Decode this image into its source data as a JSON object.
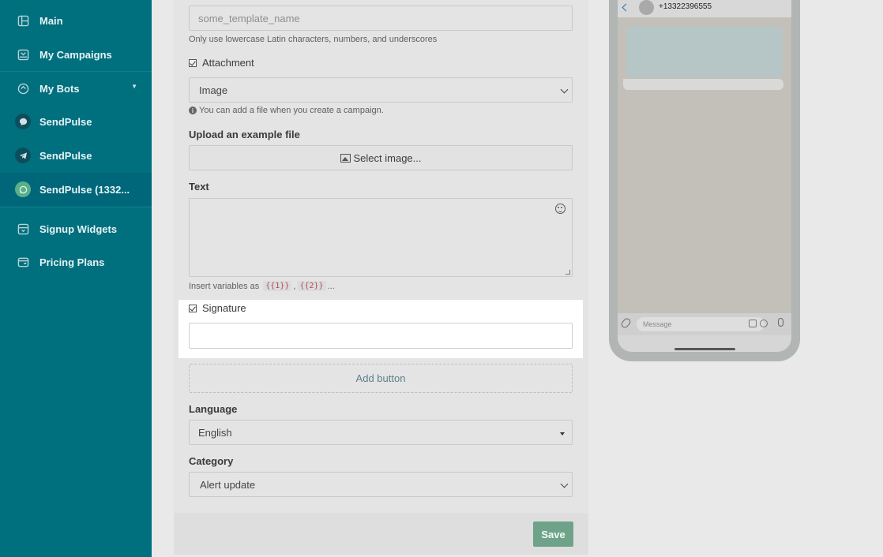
{
  "sidebar": {
    "items": [
      {
        "label": "Main",
        "icon": "dashboard-icon"
      },
      {
        "label": "My Campaigns",
        "icon": "campaigns-icon"
      },
      {
        "label": "My Bots",
        "icon": "bots-icon"
      },
      {
        "label": "SendPulse",
        "icon": "messenger-icon"
      },
      {
        "label": "SendPulse",
        "icon": "telegram-icon"
      },
      {
        "label": "SendPulse (1332...",
        "icon": "whatsapp-icon"
      },
      {
        "label": "Signup Widgets",
        "icon": "widgets-icon"
      },
      {
        "label": "Pricing Plans",
        "icon": "pricing-icon"
      }
    ]
  },
  "form": {
    "template_name_placeholder": "some_template_name",
    "template_name_hint": "Only use lowercase Latin characters, numbers, and underscores",
    "attachment_label": "Attachment",
    "attachment_type": "Image",
    "attachment_hint": "You can add a file when you create a campaign.",
    "upload_label": "Upload an example file",
    "upload_button": "Select image...",
    "text_label": "Text",
    "variables_hint_prefix": "Insert variables as",
    "var1": "{{1}}",
    "var2": "{{2}}",
    "variables_hint_suffix": "...",
    "signature_label": "Signature",
    "add_button": "Add button",
    "language_label": "Language",
    "language_value": "English",
    "category_label": "Category",
    "category_value": "Alert update",
    "save_button": "Save"
  },
  "preview": {
    "phone_number": "+13322396555",
    "message_placeholder": "Message"
  }
}
